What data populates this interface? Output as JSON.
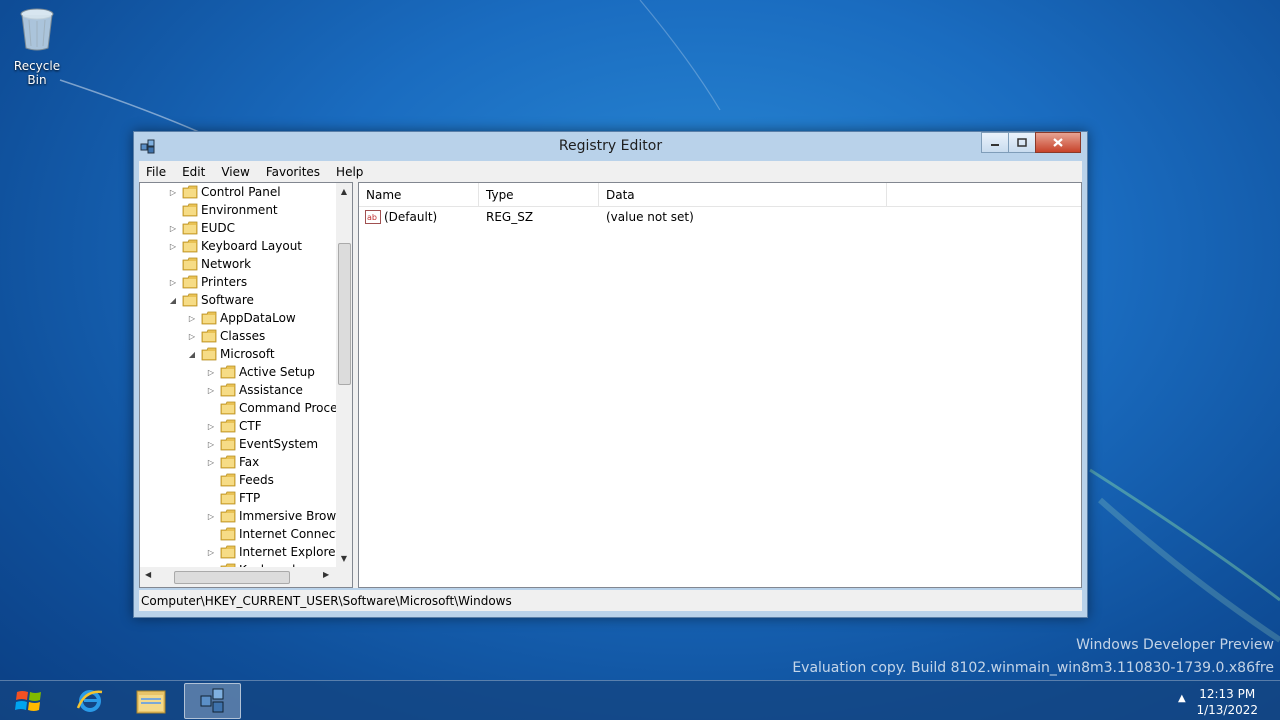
{
  "desktop": {
    "recycle_bin_label": "Recycle Bin",
    "watermark_line1": "Windows Developer Preview",
    "watermark_line2": "Evaluation copy. Build 8102.winmain_win8m3.110830-1739.0.x86fre"
  },
  "window": {
    "title": "Registry Editor",
    "menu": [
      "File",
      "Edit",
      "View",
      "Favorites",
      "Help"
    ],
    "tree": [
      {
        "label": "Control Panel",
        "level": 0,
        "expander": "collapsed"
      },
      {
        "label": "Environment",
        "level": 0,
        "expander": "none"
      },
      {
        "label": "EUDC",
        "level": 0,
        "expander": "collapsed"
      },
      {
        "label": "Keyboard Layout",
        "level": 0,
        "expander": "collapsed"
      },
      {
        "label": "Network",
        "level": 0,
        "expander": "none"
      },
      {
        "label": "Printers",
        "level": 0,
        "expander": "collapsed"
      },
      {
        "label": "Software",
        "level": 0,
        "expander": "expanded"
      },
      {
        "label": "AppDataLow",
        "level": 1,
        "expander": "collapsed"
      },
      {
        "label": "Classes",
        "level": 1,
        "expander": "collapsed"
      },
      {
        "label": "Microsoft",
        "level": 1,
        "expander": "expanded"
      },
      {
        "label": "Active Setup",
        "level": 2,
        "expander": "collapsed"
      },
      {
        "label": "Assistance",
        "level": 2,
        "expander": "collapsed"
      },
      {
        "label": "Command Processor",
        "level": 2,
        "expander": "none"
      },
      {
        "label": "CTF",
        "level": 2,
        "expander": "collapsed"
      },
      {
        "label": "EventSystem",
        "level": 2,
        "expander": "collapsed"
      },
      {
        "label": "Fax",
        "level": 2,
        "expander": "collapsed"
      },
      {
        "label": "Feeds",
        "level": 2,
        "expander": "none"
      },
      {
        "label": "FTP",
        "level": 2,
        "expander": "none"
      },
      {
        "label": "Immersive Browser",
        "level": 2,
        "expander": "collapsed"
      },
      {
        "label": "Internet Connection Wizard",
        "level": 2,
        "expander": "none"
      },
      {
        "label": "Internet Explorer",
        "level": 2,
        "expander": "collapsed"
      },
      {
        "label": "Keyboard",
        "level": 2,
        "expander": "collapsed"
      }
    ],
    "columns": [
      "Name",
      "Type",
      "Data"
    ],
    "rows": [
      {
        "name": "(Default)",
        "type": "REG_SZ",
        "data": "(value not set)",
        "icon": "string-value-icon"
      }
    ],
    "status": "Computer\\HKEY_CURRENT_USER\\Software\\Microsoft\\Windows"
  },
  "taskbar": {
    "items": [
      "start-button",
      "internet-explorer",
      "file-explorer",
      "registry-editor"
    ],
    "active": "registry-editor",
    "time": "12:13 PM",
    "date": "1/13/2022"
  }
}
